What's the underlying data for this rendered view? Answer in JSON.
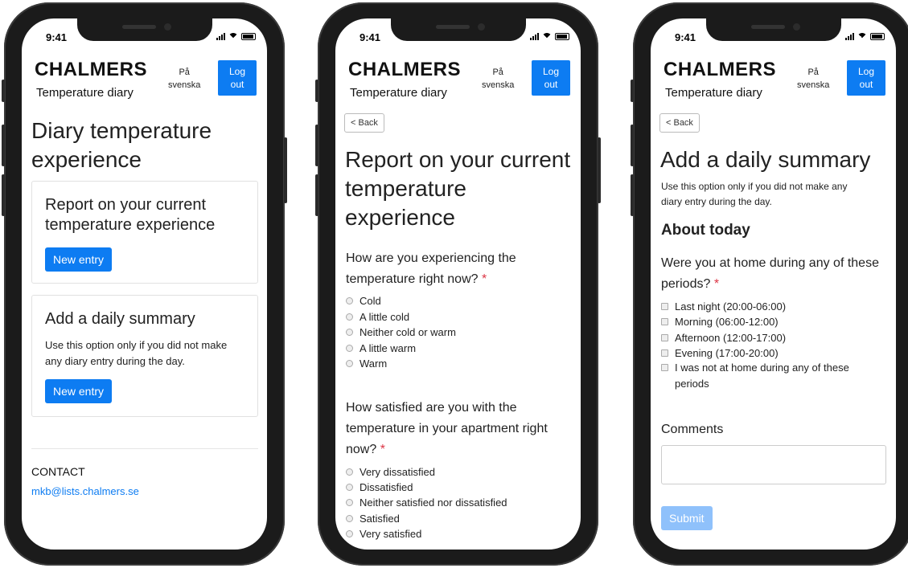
{
  "status": {
    "time": "9:41"
  },
  "header": {
    "brand": "CHALMERS",
    "subtitle": "Temperature diary",
    "language_line1": "På",
    "language_line2": "svenska",
    "logout_line1": "Log",
    "logout_line2": "out"
  },
  "screen1": {
    "title_line1": "Diary temperature",
    "title_line2": "experience",
    "card1": {
      "title_line1": "Report on your current",
      "title_line2": "temperature experience",
      "button": "New entry"
    },
    "card2": {
      "title": "Add a daily summary",
      "text_line1": "Use this option only if you did not make",
      "text_line2": "any diary entry during the day.",
      "button": "New entry"
    },
    "contact_heading": "CONTACT",
    "contact_email": "mkb@lists.chalmers.se"
  },
  "screen2": {
    "back": "< Back",
    "title_line1": "Report on your current",
    "title_line2": "temperature",
    "title_line3": "experience",
    "q1_line1": "How are you experiencing the",
    "q1_line2": "temperature right now?",
    "q1_options": [
      "Cold",
      "A little cold",
      "Neither cold or warm",
      "A little warm",
      "Warm"
    ],
    "q2_line1": "How satisfied are you with the",
    "q2_line2": "temperature in your apartment right",
    "q2_line3": "now?",
    "q2_options": [
      "Very dissatisfied",
      "Dissatisfied",
      "Neither satisfied nor dissatisfied",
      "Satisfied",
      "Very satisfied"
    ],
    "required_mark": "*"
  },
  "screen3": {
    "back": "< Back",
    "title": "Add a daily summary",
    "intro_line1": "Use this option only if you did not make any",
    "intro_line2": "diary entry during the day.",
    "section": "About today",
    "q_line1": "Were you at home during any of these",
    "q_line2": "periods?",
    "options": [
      "Last night (20:00-06:00)",
      "Morning (06:00-12:00)",
      "Afternoon (12:00-17:00)",
      "Evening (17:00-20:00)"
    ],
    "option_last_line1": "I was not at home during any of these",
    "option_last_line2": "periods",
    "comments_label": "Comments",
    "submit": "Submit",
    "required_mark": "*"
  },
  "colors": {
    "primary": "#0d7cf2",
    "submit_disabled": "#8fc1fb",
    "required": "#dc3545",
    "link": "#0d7cf2"
  }
}
